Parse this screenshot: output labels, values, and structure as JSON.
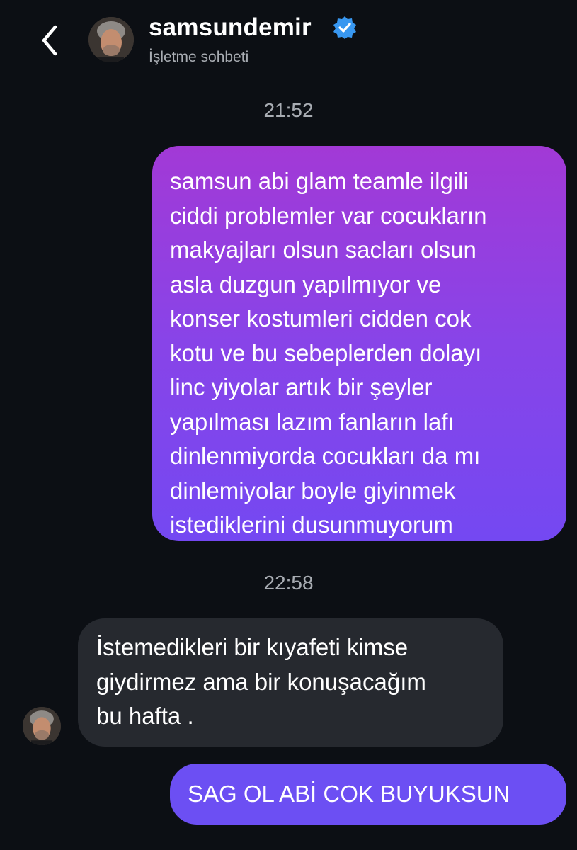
{
  "header": {
    "contact_name": "samsundemir",
    "subtitle": "İşletme sohbeti",
    "verified": true
  },
  "messages": [
    {
      "timestamp": "21:52"
    },
    {
      "direction": "outgoing",
      "lines": [
        "samsun abi glam teamle ilgili",
        "ciddi problemler var cocukların",
        "makyajları olsun sacları olsun",
        "asla duzgun yapılmıyor ve",
        "konser kostumleri cidden cok",
        "kotu ve bu sebeplerden dolayı",
        "linc yiyolar artık bir şeyler",
        "yapılması lazım fanların lafı",
        "dinlenmiyorda cocukları da mı",
        "dinlemiyolar boyle giyinmek",
        "istediklerini dusunmuyorum"
      ]
    },
    {
      "timestamp": "22:58"
    },
    {
      "direction": "incoming",
      "lines": [
        "İstemedikleri bir kıyafeti kimse",
        "giydirmez ama bir konuşacağım",
        "bu hafta ."
      ]
    },
    {
      "direction": "outgoing",
      "text": "SAG OL ABİ COK BUYUKSUN"
    }
  ],
  "colors": {
    "background": "#0c0f14",
    "outgoing_gradient_top": "#a239d6",
    "outgoing_gradient_bottom": "#7448f2",
    "outgoing_solid": "#6c4ff3",
    "incoming_bubble": "#26292f",
    "verified_badge": "#3897f0",
    "secondary_text": "#a8acb2"
  },
  "icons": {
    "back": "chevron-left-icon",
    "verified": "verified-badge-icon"
  }
}
